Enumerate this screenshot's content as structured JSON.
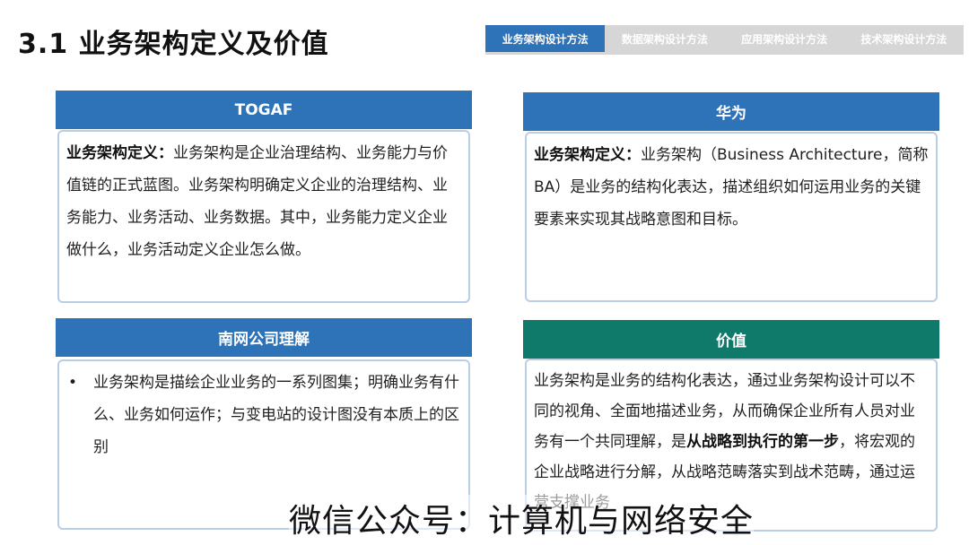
{
  "page_title": "3.1 业务架构定义及价值",
  "tabs": [
    {
      "label": "业务架构设计方法",
      "active": true
    },
    {
      "label": "数据架构设计方法",
      "active": false
    },
    {
      "label": "应用架构设计方法",
      "active": false
    },
    {
      "label": "技术架构设计方法",
      "active": false
    }
  ],
  "togaf": {
    "header": "TOGAF",
    "def_label": "业务架构定义：",
    "def_text": "业务架构是企业治理结构、业务能力与价值链的正式蓝图。业务架构明确定义企业的治理结构、业务能力、业务活动、业务数据。其中，业务能力定义企业做什么，业务活动定义企业怎么做。"
  },
  "huawei": {
    "header": "华为",
    "def_label": "业务架构定义：",
    "def_text": "业务架构（Business Architecture，简称BA）是业务的结构化表达，描述组织如何运用业务的关键要素来实现其战略意图和目标。"
  },
  "csg": {
    "header": "南网公司理解",
    "bullet": "•",
    "text": "业务架构是描绘企业业务的一系列图集；明确业务有什么、业务如何运作；与变电站的设计图没有本质上的区别"
  },
  "value": {
    "header": "价值",
    "text_1": "业务架构是业务的结构化表达，通过业务架构设计可以不同的视角、全面地描述业务，从而确保企业所有人员对业务有一个共同理解，是",
    "text_bold": "从战略到执行的第一步",
    "text_2": "，将宏观的企业战略进行分解，从战略范畴落实到战术范畴，通过运营支撑业务"
  },
  "watermark": "微信公众号：计算机与网络安全",
  "colors": {
    "tab_active": "#2e72b8",
    "tab_inactive": "#d6d6d6",
    "header_blue": "#2e72b8",
    "header_teal": "#0f7a6a",
    "panel_border": "#b8cde6"
  }
}
